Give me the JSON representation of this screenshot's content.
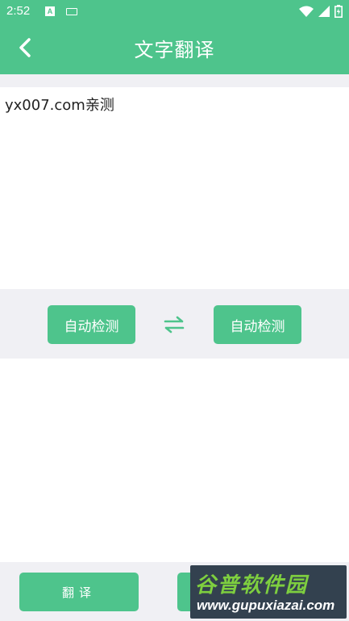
{
  "status_bar": {
    "time": "2:52",
    "icons": [
      "a-notification-icon",
      "keyboard-icon",
      "wifi-icon",
      "signal-icon",
      "battery-icon"
    ]
  },
  "header": {
    "title": "文字翻译",
    "back_icon": "chevron-left-icon"
  },
  "input": {
    "text": "yx007.com亲测"
  },
  "language_bar": {
    "source_label": "自动检测",
    "target_label": "自动检测",
    "swap_icon": "swap-arrows-icon"
  },
  "output": {
    "text": ""
  },
  "bottom": {
    "translate_label": "翻译",
    "second_label": ""
  },
  "watermark": {
    "main": "谷普软件园",
    "sub": "www.gupuxiazai.com"
  },
  "colors": {
    "accent": "#4ec48c",
    "background": "#f0f0f4",
    "watermark_bg": "#33414f",
    "watermark_green": "#7ecf3f"
  }
}
